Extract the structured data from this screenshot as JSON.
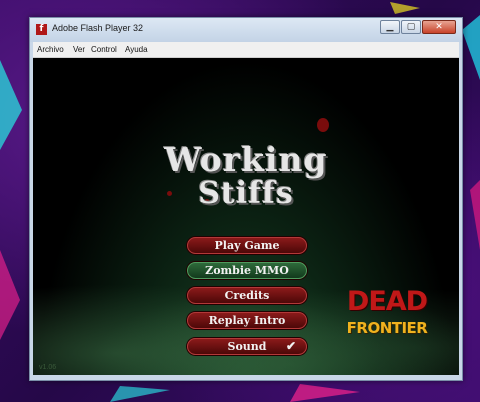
{
  "window": {
    "title": "Adobe Flash Player 32",
    "app_icon": "f",
    "controls": {
      "minimize_icon": "minimize-icon",
      "maximize_icon": "maximize-icon",
      "close_icon": "close-icon"
    }
  },
  "menubar": {
    "items": [
      "Archivo",
      "Ver",
      "Control",
      "Ayuda"
    ]
  },
  "game": {
    "logo_line1": "Working",
    "logo_line2": "Stiffs",
    "menu": [
      {
        "label": "Play Game"
      },
      {
        "label": "Zombie MMO"
      },
      {
        "label": "Credits"
      },
      {
        "label": "Replay Intro"
      },
      {
        "label": "Sound",
        "checked": true,
        "check_glyph": "✔"
      }
    ],
    "version": "v1.06",
    "brand": {
      "line1": "DEAD",
      "line2": "FRONTIER"
    }
  },
  "colors": {
    "button_red": "#6a1010",
    "button_green": "#1e4a28",
    "desktop": "#2a0a4a"
  }
}
